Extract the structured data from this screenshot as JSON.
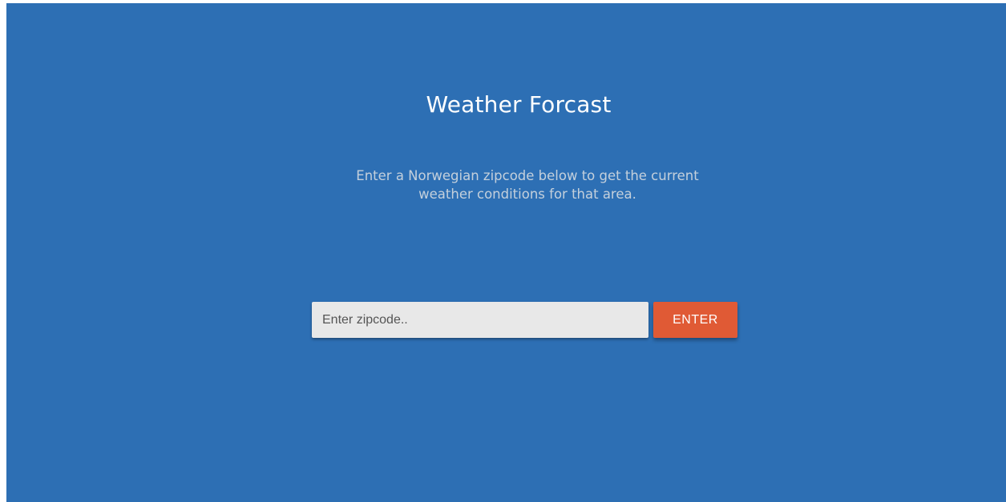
{
  "header": {
    "title": "Weather Forcast",
    "subtitle": "Enter a Norwegian zipcode below to get the current weather conditions for that area."
  },
  "search": {
    "value": "",
    "placeholder": "Enter zipcode..",
    "button_label": "ENTER"
  },
  "colors": {
    "background": "#2d6fb4",
    "button": "#e05a35",
    "input": "#e8e8e8"
  }
}
